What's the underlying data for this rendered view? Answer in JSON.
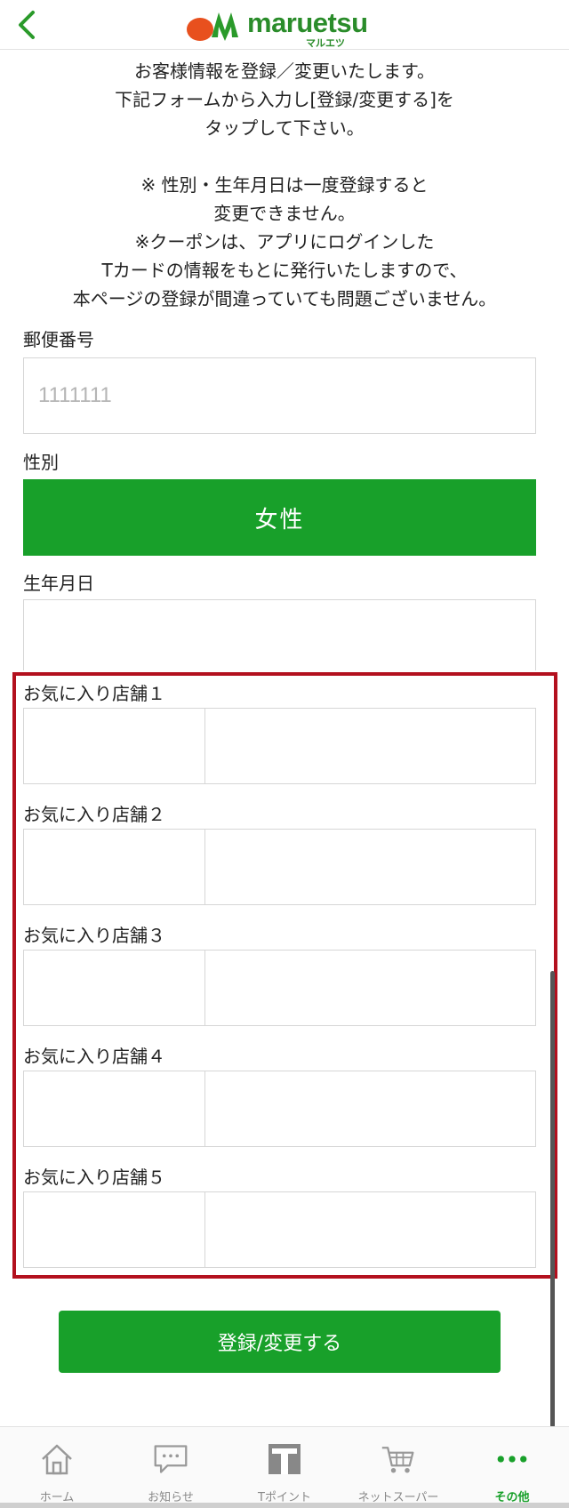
{
  "header": {
    "logo_text": "maruetsu",
    "logo_sub": "マルエツ"
  },
  "intro": {
    "lines": [
      "お客様情報を登録／変更いたします。",
      "下記フォームから入力し[登録/変更する]を",
      "タップして下さい。"
    ],
    "notes": [
      "※ 性別・生年月日は一度登録すると",
      "変更できません。",
      "※クーポンは、アプリにログインした",
      "Tカードの情報をもとに発行いたしますので、",
      "本ページの登録が間違っていても問題ございません。"
    ]
  },
  "form": {
    "postal": {
      "label": "郵便番号",
      "placeholder": "1111111"
    },
    "gender": {
      "label": "性別",
      "value": "女性"
    },
    "birthday": {
      "label": "生年月日"
    },
    "stores": [
      {
        "label": "お気に入り店舗１"
      },
      {
        "label": "お気に入り店舗２"
      },
      {
        "label": "お気に入り店舗３"
      },
      {
        "label": "お気に入り店舗４"
      },
      {
        "label": "お気に入り店舗５"
      }
    ],
    "submit_label": "登録/変更する"
  },
  "tabbar": {
    "active_color": "#18a02a",
    "tabs": [
      {
        "label": "ホーム",
        "icon": "home-icon"
      },
      {
        "label": "お知らせ",
        "icon": "chat-icon"
      },
      {
        "label": "Tポイント",
        "icon": "tpoint-icon"
      },
      {
        "label": "ネットスーパー",
        "icon": "cart-icon"
      },
      {
        "label": "その他",
        "icon": "more-icon",
        "active": true
      }
    ]
  },
  "colors": {
    "brand_green": "#18a02a",
    "highlight_red": "#b3101e"
  }
}
